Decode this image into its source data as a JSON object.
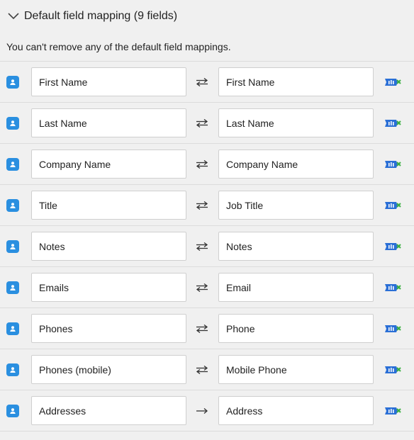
{
  "section": {
    "title": "Default field mapping (9 fields)",
    "chevron_icon": "chevron-down-icon"
  },
  "notice": "You can't remove any of the default field mappings.",
  "icons": {
    "source": "contact-card-icon",
    "destination": "crm-logo-icon",
    "bidirectional": "swap-arrows-icon",
    "one_way": "right-arrow-icon"
  },
  "colors": {
    "background": "#f0f0f0",
    "source_icon": "#2a8fe0",
    "destination_icon_blue": "#2a6fd6",
    "destination_icon_green": "#3cb043"
  },
  "mappings": [
    {
      "source": "First Name",
      "target": "First Name",
      "direction": "bidirectional"
    },
    {
      "source": "Last Name",
      "target": "Last Name",
      "direction": "bidirectional"
    },
    {
      "source": "Company Name",
      "target": "Company Name",
      "direction": "bidirectional"
    },
    {
      "source": "Title",
      "target": "Job Title",
      "direction": "bidirectional"
    },
    {
      "source": "Notes",
      "target": "Notes",
      "direction": "bidirectional"
    },
    {
      "source": "Emails",
      "target": "Email",
      "direction": "bidirectional"
    },
    {
      "source": "Phones",
      "target": "Phone",
      "direction": "bidirectional"
    },
    {
      "source": "Phones (mobile)",
      "target": "Mobile Phone",
      "direction": "bidirectional"
    },
    {
      "source": "Addresses",
      "target": "Address",
      "direction": "one_way"
    }
  ]
}
